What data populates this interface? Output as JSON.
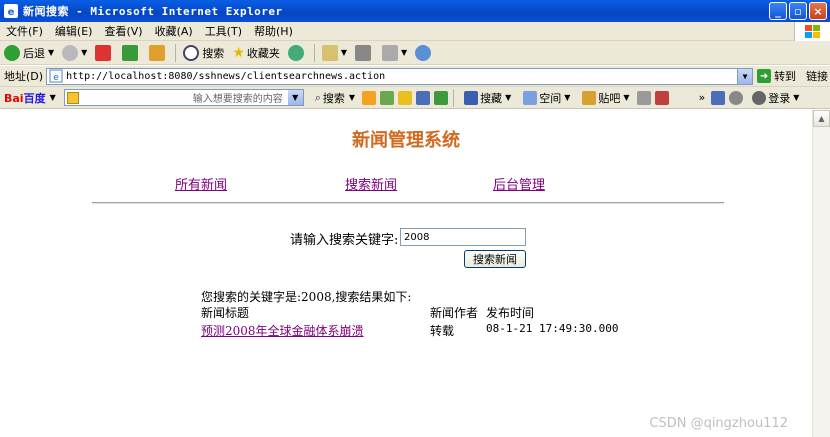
{
  "window": {
    "title": "新闻搜索 - Microsoft Internet Explorer"
  },
  "menu": [
    "文件(F)",
    "编辑(E)",
    "查看(V)",
    "收藏(A)",
    "工具(T)",
    "帮助(H)"
  ],
  "toolbar": {
    "back": "后退",
    "search": "搜索",
    "favorites": "收藏夹"
  },
  "address": {
    "label": "地址(D)",
    "url": "http://localhost:8080/sshnews/clientsearchnews.action",
    "go": "转到",
    "links": "链接"
  },
  "baidu": {
    "logo_a": "Bai",
    "logo_b": "百度",
    "placeholder": "输入想要搜索的内容",
    "search": "搜索",
    "bookmark": "搜藏",
    "space": "空间",
    "tieba": "贴吧",
    "login": "登录"
  },
  "page": {
    "title": "新闻管理系统",
    "nav": [
      "所有新闻",
      "搜索新闻",
      "后台管理"
    ],
    "search_label": "请输入搜索关键字:",
    "search_value": "2008",
    "search_button": "搜索新闻",
    "result_summary": "您搜索的关键字是:2008,搜索结果如下:",
    "table": {
      "headers": [
        "新闻标题",
        "新闻作者",
        "发布时间"
      ],
      "rows": [
        {
          "title": "预测2008年全球金融体系崩溃",
          "author": "转载",
          "time": "08-1-21 17:49:30.000"
        }
      ]
    }
  },
  "watermark": "CSDN @qingzhou112",
  "colors": {
    "title": "#d2691e",
    "link_visited": "#800080",
    "titlebar": "#0a5fe6"
  }
}
